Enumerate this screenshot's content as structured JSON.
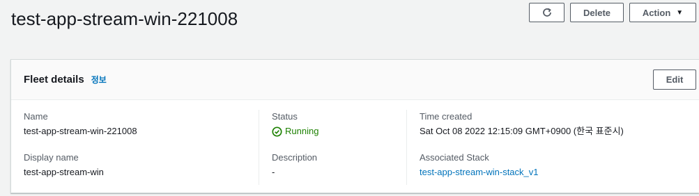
{
  "header": {
    "title": "test-app-stream-win-221008",
    "refresh_icon": "refresh-icon",
    "delete_label": "Delete",
    "action_label": "Action"
  },
  "panel": {
    "title": "Fleet details",
    "info_link": "정보",
    "edit_label": "Edit"
  },
  "details": {
    "name_label": "Name",
    "name_value": "test-app-stream-win-221008",
    "display_name_label": "Display name",
    "display_name_value": "test-app-stream-win",
    "status_label": "Status",
    "status_value": "Running",
    "status_color": "#1d8102",
    "description_label": "Description",
    "description_value": "-",
    "time_created_label": "Time created",
    "time_created_value": "Sat Oct 08 2022 12:15:09 GMT+0900 (한국 표준시)",
    "stack_label": "Associated Stack",
    "stack_value": "test-app-stream-win-stack_v1"
  }
}
